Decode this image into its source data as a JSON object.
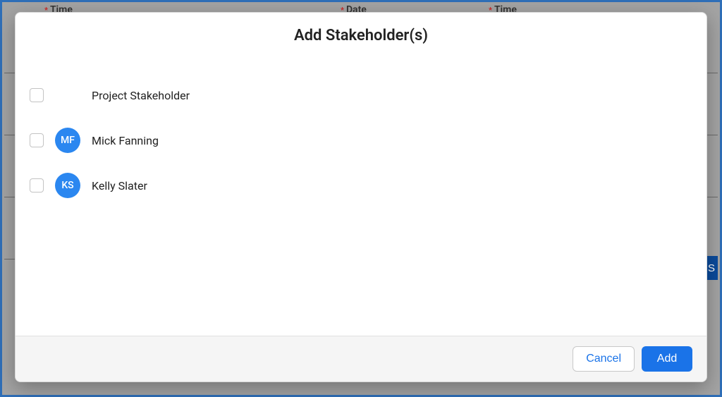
{
  "background": {
    "field_time1": "Time",
    "field_date": "Date",
    "field_time2": "Time",
    "side_label": "S"
  },
  "modal": {
    "title": "Add Stakeholder(s)",
    "items": [
      {
        "label": "Project Stakeholder",
        "initials": ""
      },
      {
        "label": "Mick Fanning",
        "initials": "MF"
      },
      {
        "label": "Kelly Slater",
        "initials": "KS"
      }
    ],
    "footer": {
      "cancel": "Cancel",
      "add": "Add"
    }
  },
  "colors": {
    "avatar_bg": "#2b87f0",
    "primary_btn": "#1a73e8"
  }
}
